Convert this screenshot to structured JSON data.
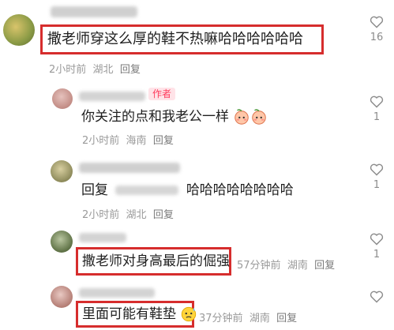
{
  "comments": [
    {
      "text": "撒老师穿这么厚的鞋不热嘛哈哈哈哈哈哈",
      "time": "2小时前",
      "location": "湖北",
      "reply_label": "回复",
      "likes": "16",
      "highlighted": true
    },
    {
      "author_badge": "作者",
      "text": "你关注的点和我老公一样",
      "emoji": "peach-face-icon",
      "time": "2小时前",
      "location": "海南",
      "reply_label": "回复",
      "likes": "1"
    },
    {
      "text_prefix": "回复",
      "text_suffix": "哈哈哈哈哈哈哈哈",
      "time": "2小时前",
      "location": "湖北",
      "reply_label": "回复",
      "likes": "1"
    },
    {
      "text": "撒老师对身高最后的倔强",
      "time": "57分钟前",
      "location": "湖南",
      "reply_label": "回复",
      "likes": "1",
      "highlighted": true
    },
    {
      "text": "里面可能有鞋垫",
      "emoji": "sweat-face-icon",
      "time": "37分钟前",
      "location": "湖南",
      "reply_label": "回复",
      "highlighted": true
    }
  ],
  "colors": {
    "highlight_border": "#d62d2d",
    "author_badge_text": "#ff3b5c",
    "author_badge_bg": "#ffe3e8",
    "meta_text": "#9a9a9a"
  }
}
